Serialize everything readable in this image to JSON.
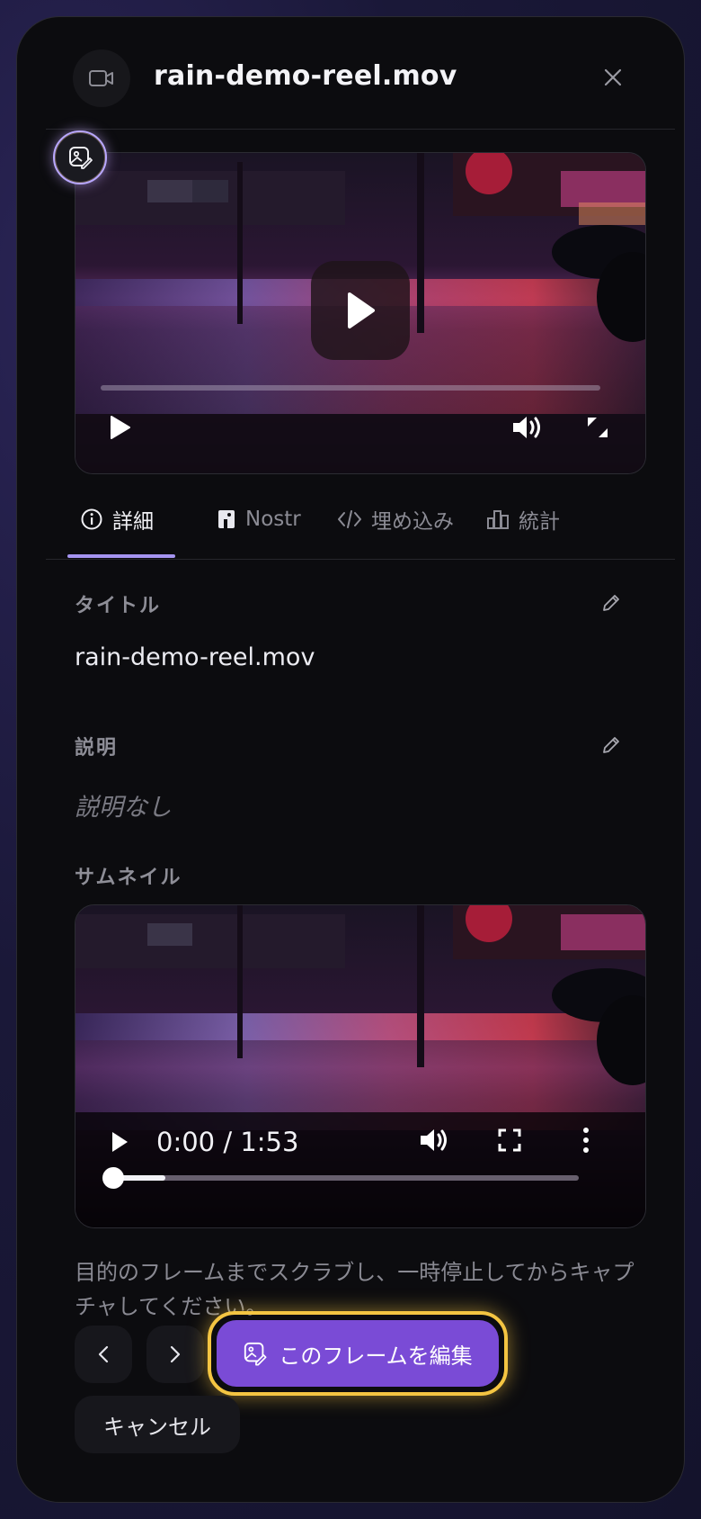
{
  "modal": {
    "title": "rain-demo-reel.mov",
    "file_icon": "video-camera-icon",
    "close_icon": "close-icon"
  },
  "player": {
    "big_play_icon": "play-icon",
    "progress": 0,
    "controls": [
      "play-icon",
      "volume-icon",
      "fullscreen-icon"
    ]
  },
  "tabs": [
    {
      "label": "詳細",
      "icon": "info-icon",
      "active": true
    },
    {
      "label": "Nostr",
      "icon": "nostr-icon",
      "active": false
    },
    {
      "label": "埋め込み",
      "icon": "code-icon",
      "active": false
    },
    {
      "label": "統計",
      "icon": "bar-chart-icon",
      "active": false
    }
  ],
  "details": {
    "title_label": "タイトル",
    "title_value": "rain-demo-reel.mov",
    "description_label": "説明",
    "description_value": "説明なし",
    "thumbnail_label": "サムネイル"
  },
  "thumbnail_player": {
    "time": "0:00 / 1:53",
    "progress": 0.0
  },
  "help_text": "目的のフレームまでスクラブし、一時停止してからキャプチャしてください。",
  "actions": {
    "prev_icon": "chevron-left-icon",
    "next_icon": "chevron-right-icon",
    "edit_frame_label": "このフレームを編集",
    "cancel_label": "キャンセル"
  },
  "colors": {
    "accent": "#7a4bd6",
    "highlight": "#f4c542",
    "tab_underline": "#a594f0",
    "background": "#0c0c0f"
  }
}
